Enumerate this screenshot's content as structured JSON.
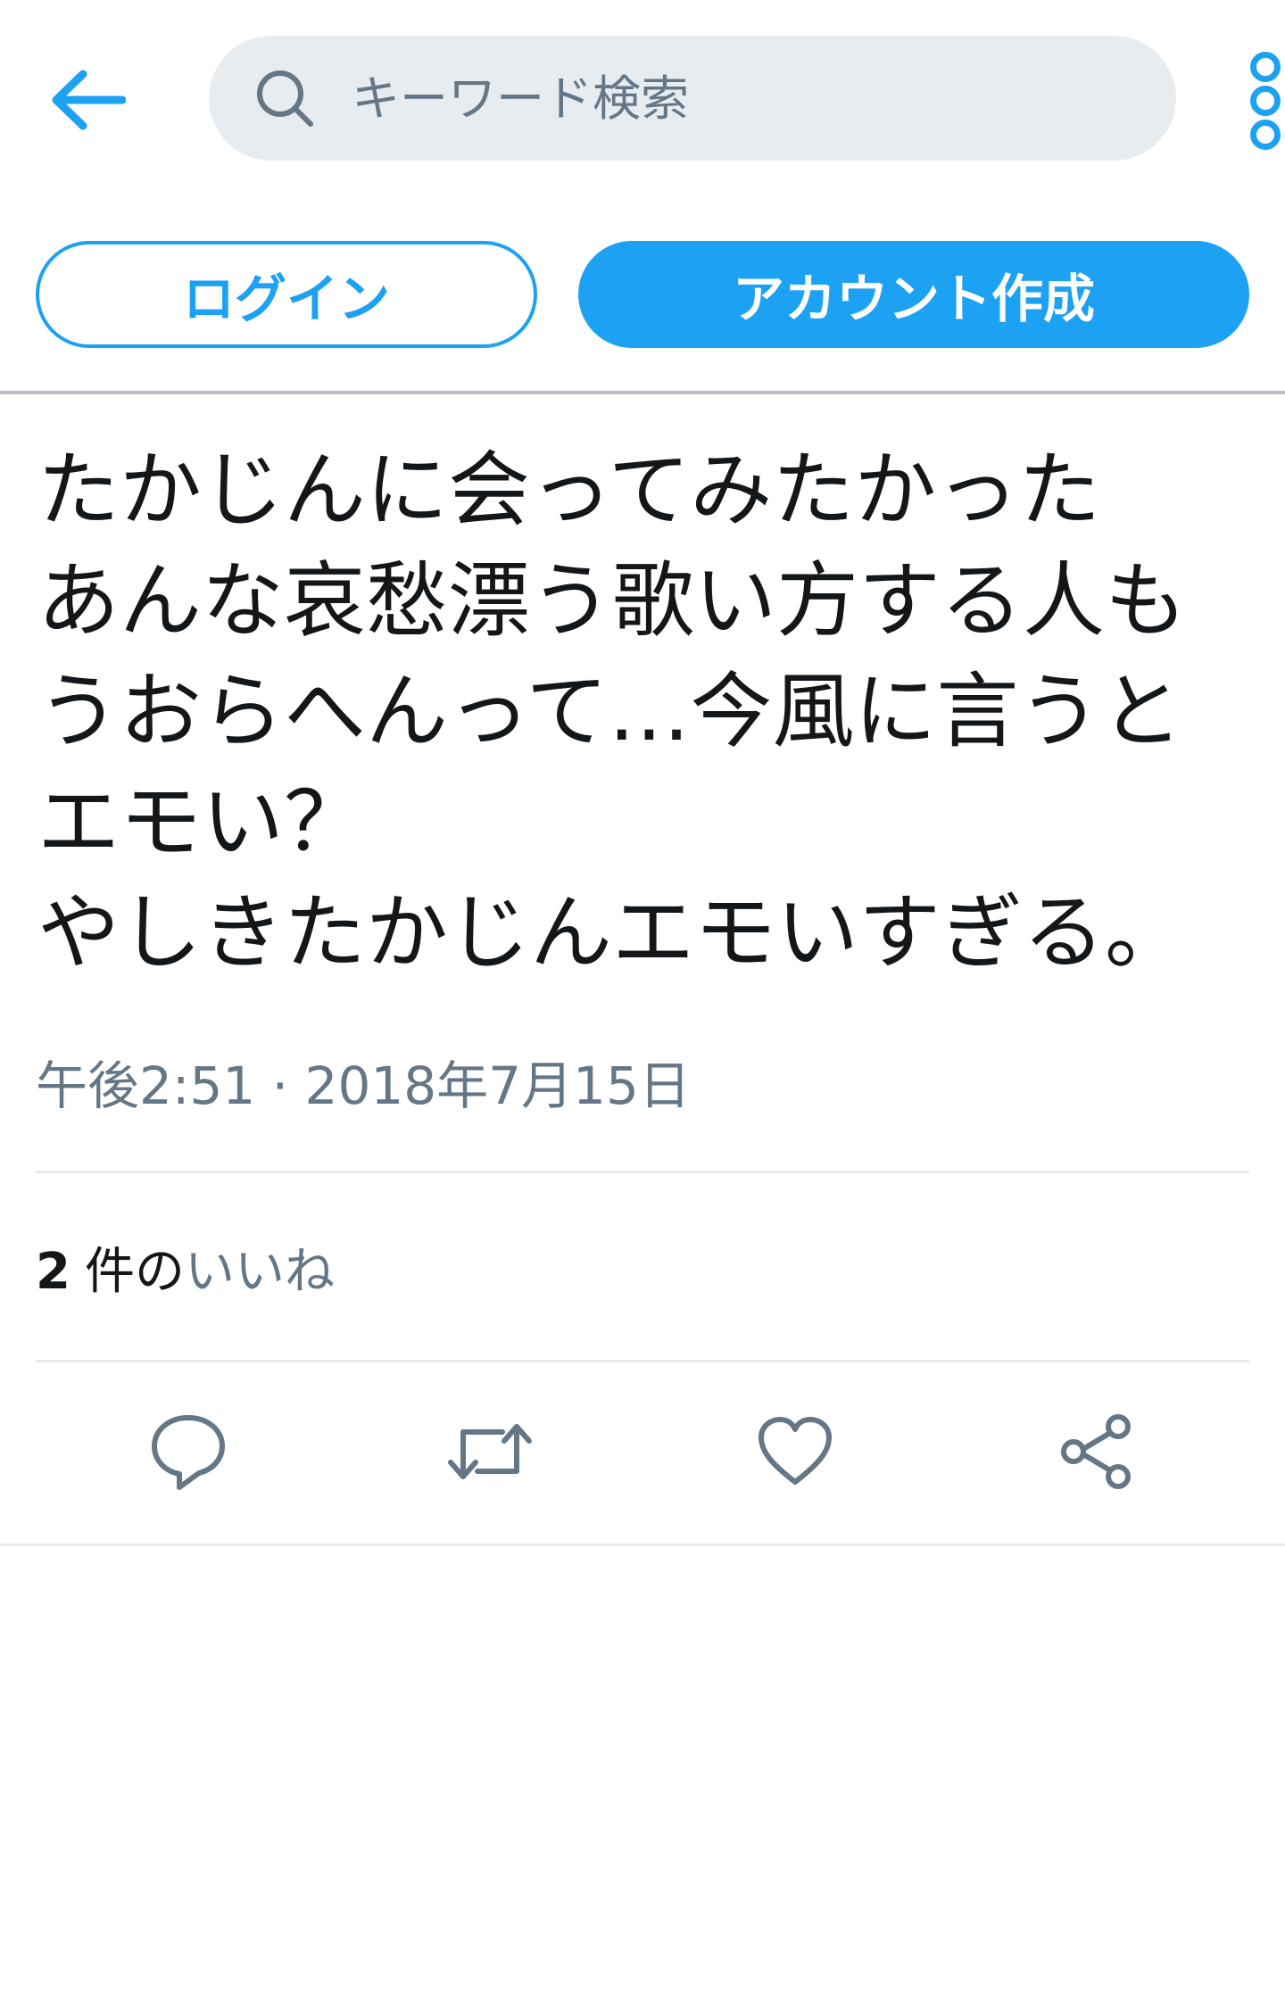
{
  "search": {
    "placeholder": "キーワード検索"
  },
  "auth": {
    "login_label": "ログイン",
    "signup_label": "アカウント作成"
  },
  "tweet": {
    "text": "たかじんに会ってみたかった\nあんな哀愁漂う歌い方する人も\nうおらへんって…今風に言うと\nエモい？\nやしきたかじんエモいすぎる。",
    "timestamp": "午後2:51 · 2018年7月15日",
    "likes": {
      "count": "2",
      "unit": "件の",
      "label": "いいね"
    }
  },
  "icons": {
    "back": "arrow-left-icon",
    "search": "search-icon",
    "more": "more-vertical-icon",
    "reply": "reply-icon",
    "retweet": "retweet-icon",
    "like": "heart-icon",
    "share": "share-icon"
  },
  "colors": {
    "accent": "#1da1f2",
    "text": "#14171a",
    "secondary_text": "#657786",
    "search_bg": "#e6ecf0",
    "divider": "#e6ecf0"
  }
}
